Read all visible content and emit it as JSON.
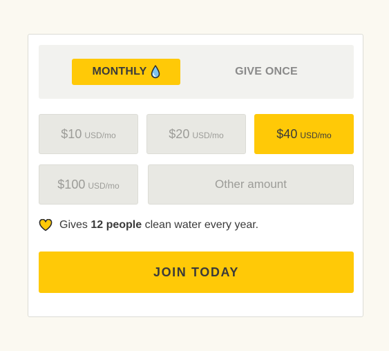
{
  "frequency": {
    "monthly_label": "MONTHLY",
    "once_label": "GIVE ONCE",
    "selected": "monthly"
  },
  "amounts": [
    {
      "value": "$10",
      "unit": "USD/mo",
      "selected": false
    },
    {
      "value": "$20",
      "unit": "USD/mo",
      "selected": false
    },
    {
      "value": "$40",
      "unit": "USD/mo",
      "selected": true
    },
    {
      "value": "$100",
      "unit": "USD/mo",
      "selected": false
    }
  ],
  "other_amount_label": "Other amount",
  "impact": {
    "prefix": "Gives ",
    "highlight": "12 people",
    "suffix": " clean water every year."
  },
  "join_label": "JOIN TODAY",
  "icons": {
    "drop": "water-drop-icon",
    "heart": "heart-icon"
  },
  "colors": {
    "accent": "#ffc907",
    "page_bg": "#fbf9f1",
    "card_bg": "#ffffff",
    "panel_bg": "#f2f2ef",
    "option_bg": "#e8e8e3",
    "muted_text": "#9c9c98",
    "text": "#3a3a3a"
  }
}
